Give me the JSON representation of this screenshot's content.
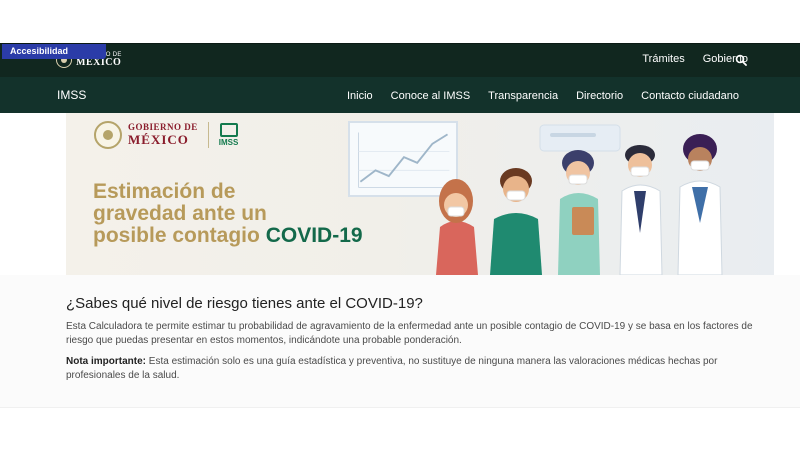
{
  "accessibility": {
    "label": "Accesibilidad"
  },
  "gov_logo": {
    "small": "GOBIERNO DE",
    "big": "MÉXICO"
  },
  "top_nav": {
    "tramites": "Trámites",
    "gobierno": "Gobierno",
    "search_icon": "search-icon"
  },
  "main_nav": {
    "brand": "IMSS",
    "items": [
      "Inicio",
      "Conoce al IMSS",
      "Transparencia",
      "Directorio",
      "Contacto ciudadano"
    ]
  },
  "banner": {
    "gob_small": "GOBIERNO DE",
    "gob_big": "MÉXICO",
    "imss_label": "IMSS",
    "title_line1": "Estimación de",
    "title_line2": "gravedad ante un",
    "title_line3_prefix": "posible contagio",
    "title_highlight": "COVID-19"
  },
  "content": {
    "question": "¿Sabes qué nivel de riesgo tienes ante el COVID-19?",
    "paragraph": "Esta Calculadora te permite estimar tu probabilidad de agravamiento de la enfermedad ante un posible contagio de COVID-19 y se basa en los factores de riesgo que puedas presentar en estos momentos, indicándote una probable ponderación.",
    "note_label": "Nota importante:",
    "note_text": " Esta estimación solo es una guía estadística y preventiva, no sustituye de ninguna manera las valoraciones médicas hechas por profesionales de la salud."
  },
  "colors": {
    "topbar": "#11271f",
    "navbar": "#13322b",
    "banner_gold": "#b79a5a",
    "banner_green": "#13694a",
    "gob_red": "#8a1c2c",
    "access_blue": "#2b3ca8"
  }
}
